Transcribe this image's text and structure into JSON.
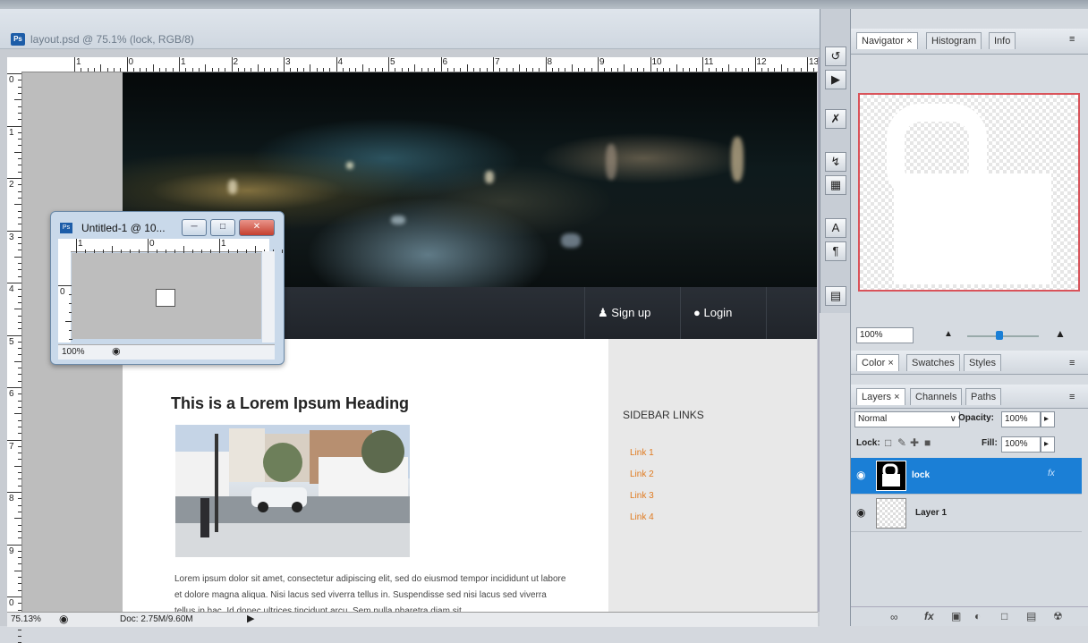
{
  "document": {
    "title": "layout.psd @ 75.1% (lock, RGB/8)",
    "ps_badge": "Ps",
    "ruler_h": [
      "1",
      "0",
      "1",
      "2",
      "3",
      "4",
      "5",
      "6",
      "7",
      "8",
      "9",
      "10",
      "11",
      "12",
      "13"
    ],
    "ruler_v": [
      "0",
      "1",
      "2",
      "3",
      "4",
      "5",
      "6",
      "7",
      "8",
      "9",
      "0"
    ],
    "zoom": "75.13%",
    "doc_info": "Doc: 2.75M/9.60M"
  },
  "site": {
    "nav": {
      "signup": "Sign up",
      "login": "Login"
    },
    "heading": "This is a Lorem Ipsum  Heading",
    "body": "Lorem ipsum dolor sit amet, consectetur adipiscing elit, sed do eiusmod tempor incididunt ut labore et dolore magna aliqua. Nisi lacus sed viverra tellus in. Suspendisse sed nisi lacus sed viverra tellus in hac. Id donec ultrices tincidunt arcu. Sem nulla pharetra diam sit",
    "sidebar_title": "SIDEBAR LINKS",
    "links": [
      "Link 1",
      "Link 2",
      "Link 3",
      "Link 4"
    ]
  },
  "small_window": {
    "title": "Untitled-1 @ 10...",
    "ruler": [
      "1",
      "0",
      "1"
    ],
    "ruler_v": [
      "0"
    ],
    "zoom": "100%"
  },
  "panels": {
    "navigator": {
      "tabs": [
        "Navigator ×",
        "Histogram",
        "Info"
      ],
      "zoom": "100%",
      "zoom_level": 0.45
    },
    "color": {
      "tabs": [
        "Color ×",
        "Swatches",
        "Styles"
      ]
    },
    "layers": {
      "tabs": [
        "Layers ×",
        "Channels",
        "Paths"
      ],
      "blend_mode": "Normal",
      "opacity_label": "Opacity:",
      "opacity": "100%",
      "lock_label": "Lock:",
      "fill_label": "Fill:",
      "fill": "100%",
      "items": [
        {
          "name": "lock",
          "selected": true,
          "fx": "fx"
        },
        {
          "name": "Layer 1",
          "selected": false
        }
      ],
      "bottom_icons": [
        "link-icon",
        "fx-icon",
        "mask-icon",
        "adjustment-icon",
        "folder-icon",
        "new-layer-icon",
        "trash-icon"
      ]
    }
  },
  "colors": {
    "selection": "#1b7fd6",
    "link": "#e07a1f",
    "navigator_frame": "#d9535a",
    "navbar": "#22262c"
  }
}
